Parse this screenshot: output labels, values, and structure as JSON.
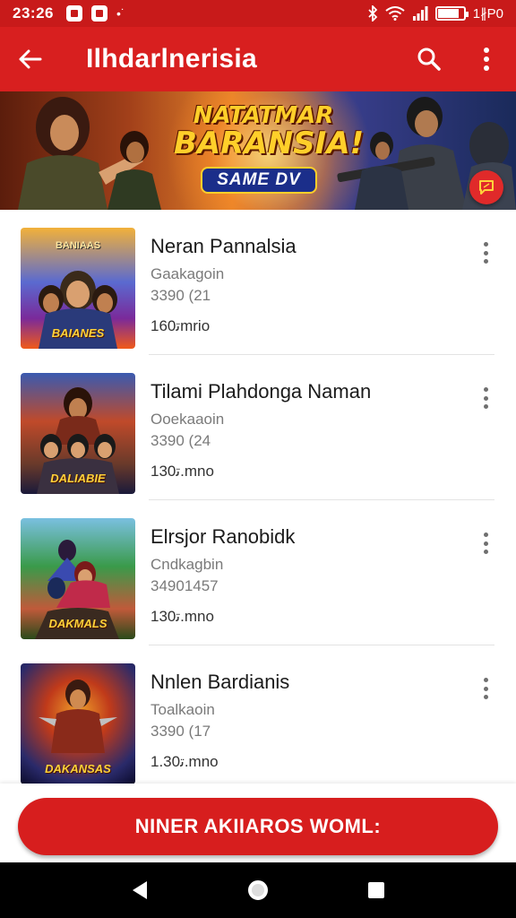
{
  "status_bar": {
    "time": "23:26",
    "right_text": "1∦P0",
    "battery_level": 0.85,
    "icons": [
      "app-icon",
      "app-icon",
      "more-dots-icon",
      "bluetooth-icon",
      "wifi-icon",
      "signal-icon",
      "battery-icon"
    ]
  },
  "app_bar": {
    "title": "Ilhdarlnerisia",
    "icons": [
      "back-arrow-icon",
      "search-icon",
      "more-vert-icon"
    ]
  },
  "banner": {
    "title_line1": "NATATMAR",
    "title_line2": "BARANSIA!",
    "pill_text": "SAME DV",
    "fab_icon": "chat-icon"
  },
  "items": [
    {
      "title": "Neran Pannalsia",
      "subtitle": "Gaakagoin",
      "number": "3390 (21",
      "price": "ﺗ160mrio",
      "thumb_top": "BANIAAS",
      "thumb_label": "BAIANES"
    },
    {
      "title": "Tilami Plahdonga Naman",
      "subtitle": "Ooekaaoin",
      "number": "3390 (24",
      "price": "ﺗ130.mno",
      "thumb_top": "",
      "thumb_label": "DALIABIE"
    },
    {
      "title": "Elrsjor Ranobidk",
      "subtitle": "Cndkagbin",
      "number": "34901457",
      "price": "ﺗ130.mno",
      "thumb_top": "",
      "thumb_label": "DAKMALS"
    },
    {
      "title": "Nnlen Bardianis",
      "subtitle": "Toalkaoin",
      "number": "3390 (17",
      "price": "ﺗ1.30.mno",
      "thumb_top": "",
      "thumb_label": "DAKANSAS"
    }
  ],
  "cta": {
    "label": "NINER AKIIAROS WOML:"
  },
  "colors": {
    "primary": "#d81f1f",
    "status_bar": "#c81a1a",
    "text_secondary": "#7a7a7a"
  },
  "nav_bar": {
    "icons": [
      "back-triangle-icon",
      "home-circle-icon",
      "recents-square-icon"
    ]
  }
}
